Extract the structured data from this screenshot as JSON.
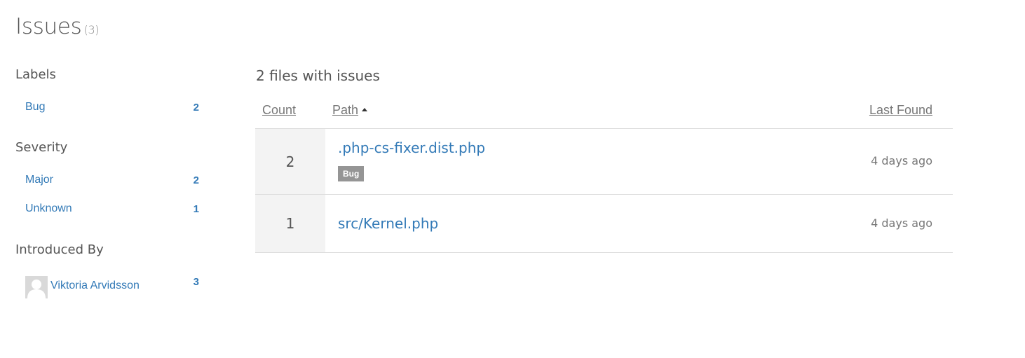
{
  "page": {
    "title": "Issues",
    "count": "(3)"
  },
  "sidebar": {
    "labels": {
      "heading": "Labels",
      "items": [
        {
          "label": "Bug",
          "count": "2"
        }
      ]
    },
    "severity": {
      "heading": "Severity",
      "items": [
        {
          "label": "Major",
          "count": "2"
        },
        {
          "label": "Unknown",
          "count": "1"
        }
      ]
    },
    "introduced_by": {
      "heading": "Introduced By",
      "items": [
        {
          "label": "Viktoria Arvidsson",
          "count": "3",
          "icon": "avatar-placeholder"
        }
      ]
    }
  },
  "main": {
    "heading": "2 files with issues",
    "table": {
      "columns": {
        "count": "Count",
        "path": "Path",
        "last_found": "Last Found"
      },
      "sort": {
        "column": "path",
        "direction": "ascending"
      },
      "rows": [
        {
          "count": "2",
          "path": ".php-cs-fixer.dist.php",
          "labels": [
            "Bug"
          ],
          "last_found": "4 days ago"
        },
        {
          "count": "1",
          "path": "src/Kernel.php",
          "labels": [],
          "last_found": "4 days ago"
        }
      ]
    }
  },
  "colors": {
    "link": "#337ab7",
    "text": "#555555",
    "muted": "#777777",
    "badge": "#959595",
    "count_cell_bg": "#f3f3f3",
    "divider": "#dddddd"
  }
}
